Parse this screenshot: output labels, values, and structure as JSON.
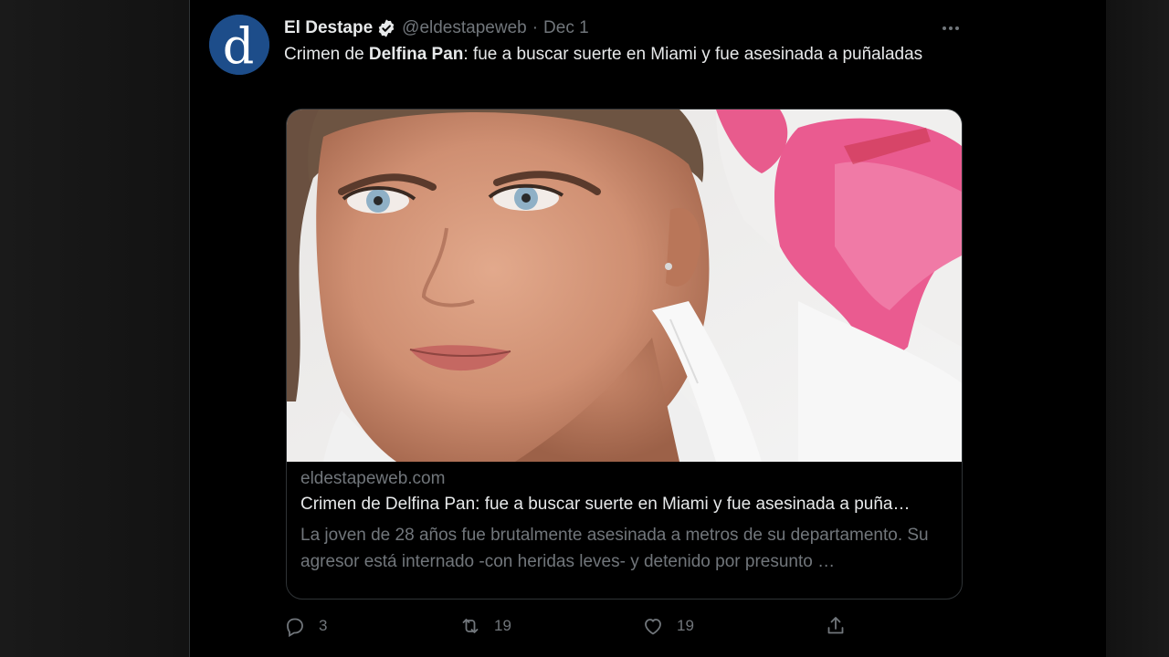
{
  "tweet": {
    "author_name": "El Destape",
    "handle": "@eldestapeweb",
    "separator": "·",
    "date": "Dec 1",
    "text_prefix": "Crimen de ",
    "text_bold": "Delfina Pan",
    "text_suffix": ": fue a buscar suerte en Miami y fue asesinada a puñaladas"
  },
  "card": {
    "domain": "eldestapeweb.com",
    "title": "Crimen de Delfina Pan: fue a buscar suerte en Miami y fue asesinada a puña…",
    "description": "La joven de 28 años fue brutalmente asesinada a metros de su departamento. Su agresor está internado -con heridas leves- y detenido por presunto …"
  },
  "actions": {
    "reply_count": "3",
    "retweet_count": "19",
    "like_count": "19"
  },
  "colors": {
    "background": "#000000",
    "text_primary": "#e7e9ea",
    "text_secondary": "#71767b",
    "border": "#2f3336",
    "avatar": "#1d4d8a"
  },
  "icons": {
    "avatar": "eldestape-logo",
    "verified": "verified-badge-icon",
    "more": "more-horizontal-icon",
    "reply": "reply-icon",
    "retweet": "retweet-icon",
    "like": "heart-icon",
    "share": "share-icon"
  }
}
